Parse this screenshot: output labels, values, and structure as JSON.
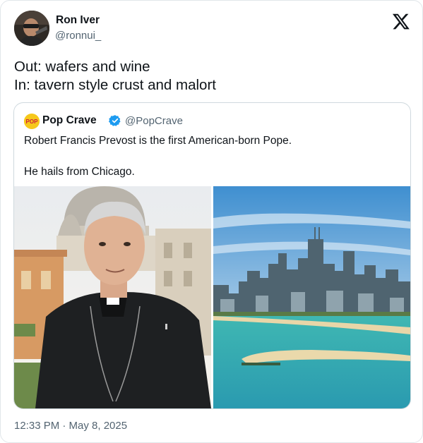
{
  "author": {
    "name": "Ron Iver",
    "handle": "@ronnui_"
  },
  "tweet": {
    "line1": "Out: wafers and wine",
    "line2": "In: tavern style crust and malort"
  },
  "quote": {
    "avatar_text": "POP",
    "name": "Pop Crave",
    "handle": "@PopCrave",
    "line1": "Robert Francis Prevost is the first American-born Pope.",
    "line2": "He hails from Chicago."
  },
  "timestamp": "12:33 PM · May 8, 2025",
  "icons": {
    "brand": "x-logo-icon",
    "verified": "verified-badge-icon"
  },
  "colors": {
    "text": "#0f1419",
    "secondary": "#536471",
    "verified": "#1d9bf0",
    "border": "#cfd9de"
  }
}
